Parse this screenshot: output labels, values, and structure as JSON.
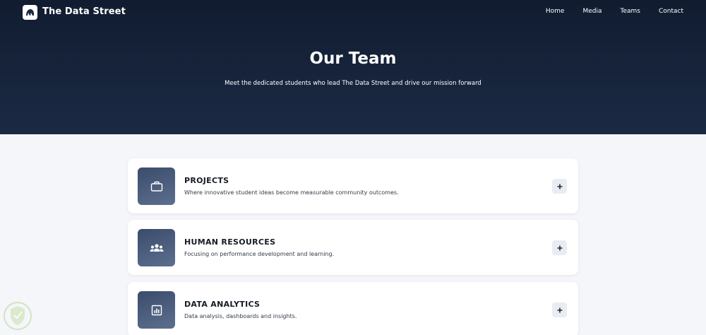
{
  "nav": {
    "brand": "The Data Street",
    "links": [
      "Home",
      "Media",
      "Teams",
      "Contact"
    ]
  },
  "hero": {
    "title": "Our Team",
    "subtitle": "Meet the dedicated students who lead The Data Street and drive our mission forward"
  },
  "cards": [
    {
      "title": "PROJECTS",
      "description": "Where innovative student ideas become measurable community outcomes.",
      "icon": "briefcase-icon"
    },
    {
      "title": "HUMAN RESOURCES",
      "description": "Focusing on performance development and learning.",
      "icon": "people-icon"
    },
    {
      "title": "DATA ANALYTICS",
      "description": "Data analysis, dashboards and insights.",
      "icon": "chart-icon"
    }
  ],
  "colors": {
    "hero_bg": "#142036",
    "icon_tile": "#4a5b7b",
    "card_bg": "#ffffff",
    "page_bg": "#f4f6f9"
  }
}
